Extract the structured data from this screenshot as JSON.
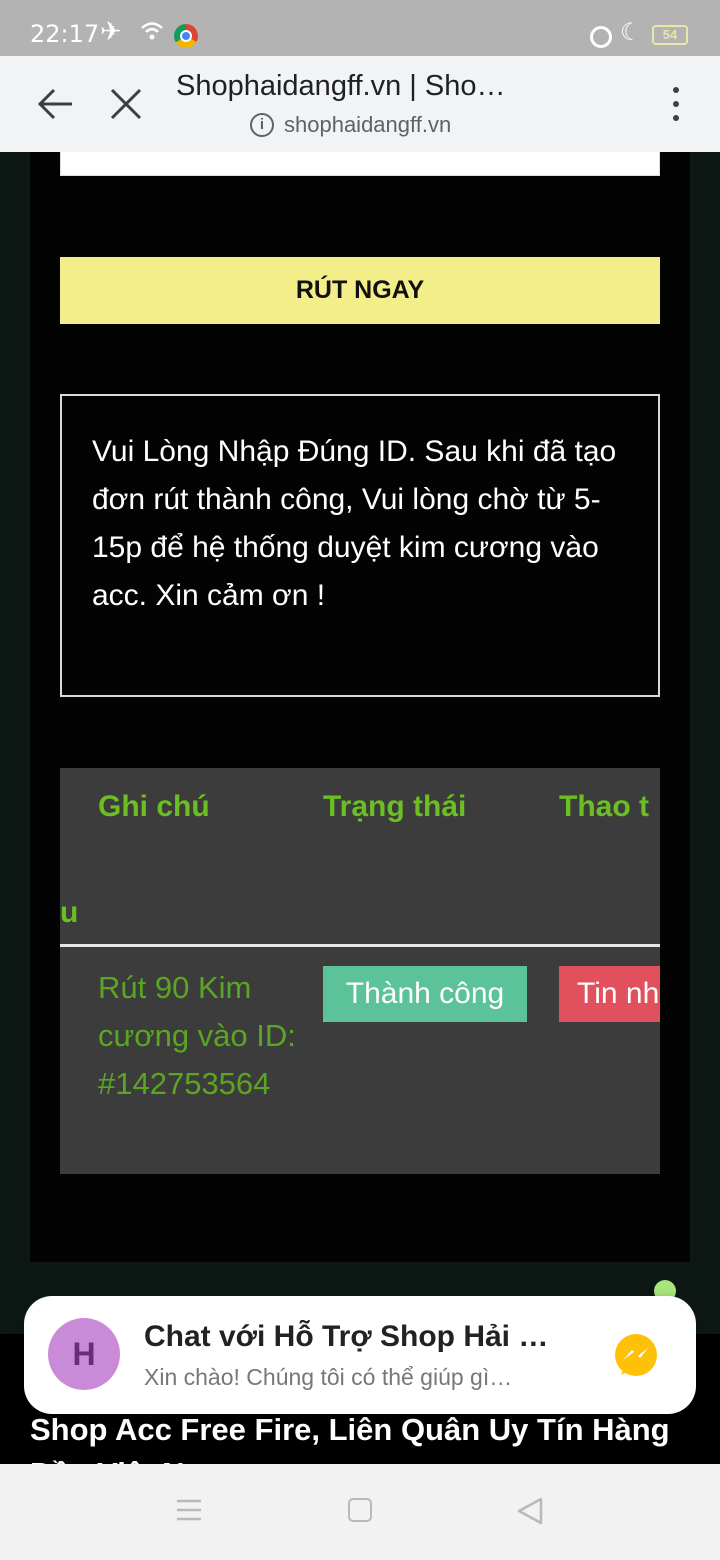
{
  "status_bar": {
    "time": "22:17",
    "battery": "54",
    "icons": [
      "airplane-icon",
      "wifi-icon",
      "chrome-icon",
      "dnd-icon",
      "moon-icon",
      "battery-icon"
    ]
  },
  "browser": {
    "title": "Shophaidangff.vn | Sho…",
    "url": "shophaidangff.vn",
    "info_glyph": "i"
  },
  "form": {
    "submit_label": "RÚT NGAY"
  },
  "notice": {
    "text": "Vui Lòng Nhập Đúng ID. Sau khi đã tạo đơn rút thành công, Vui lòng chờ từ 5-15p để hệ thống duyệt kim cương vào acc. Xin cảm ơn !"
  },
  "history_table": {
    "headers": [
      "Ghi chú",
      "Trạng thái",
      "Thao t"
    ],
    "cut_header": "u",
    "rows": [
      {
        "note": "Rút 90 Kim cương vào ID: #142753564",
        "status": "Thành công",
        "action": "Tin nh"
      }
    ]
  },
  "chat_widget": {
    "avatar_letter": "H",
    "title": "Chat với Hỗ Trợ Shop Hải …",
    "subtitle": "Xin chào! Chúng tôi có thể giúp gì…"
  },
  "footer": {
    "title": "Shop Acc Free Fire, Liên Quân Uy Tín Hàng Đầu Việt Nam"
  },
  "colors": {
    "accent_yellow": "#f3ee8a",
    "table_green": "#6cbf22",
    "success": "#5bc29a",
    "danger": "#e0505d",
    "table_bg": "#3c3c3c"
  }
}
